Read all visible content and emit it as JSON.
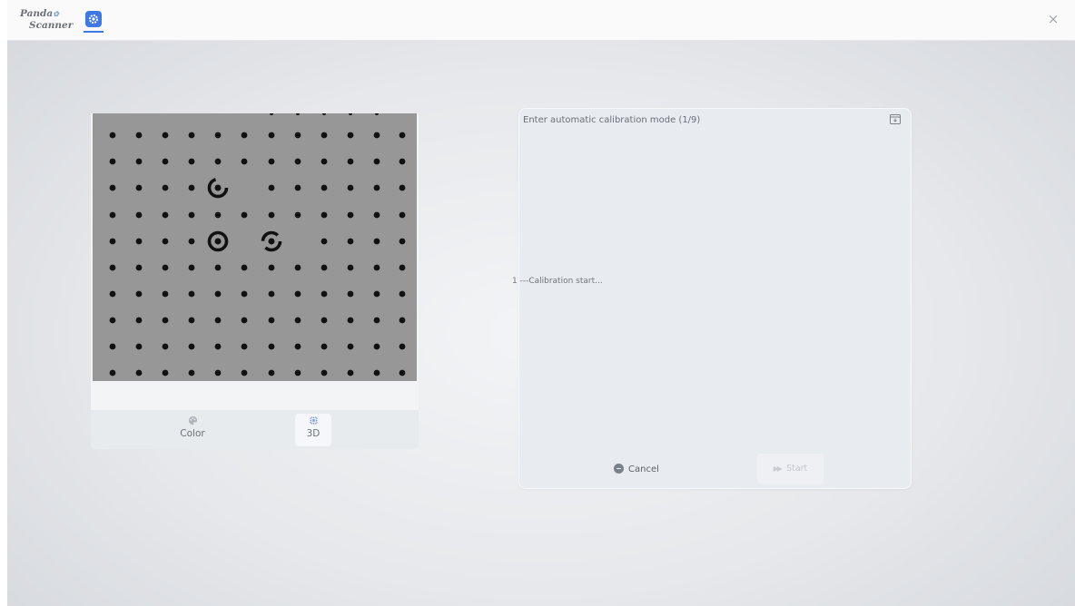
{
  "app": {
    "logo_line1": "Panda",
    "logo_line2": "Scanner",
    "tab_icon": "gear-icon",
    "close_glyph": "×",
    "accent": "#3e78e6"
  },
  "camera_panel": {
    "preview_background": "#979797",
    "modes": [
      {
        "label": "Color",
        "icon": "palette-icon",
        "selected": false
      },
      {
        "label": "3D",
        "icon": "3d-sphere-icon",
        "selected": true
      }
    ]
  },
  "calibration": {
    "title": "Enter automatic calibration mode (1/9)",
    "log_lines": [
      "1 ---Calibration start..."
    ],
    "cancel_label": "Cancel",
    "start_label": "Start",
    "start_enabled": false
  }
}
